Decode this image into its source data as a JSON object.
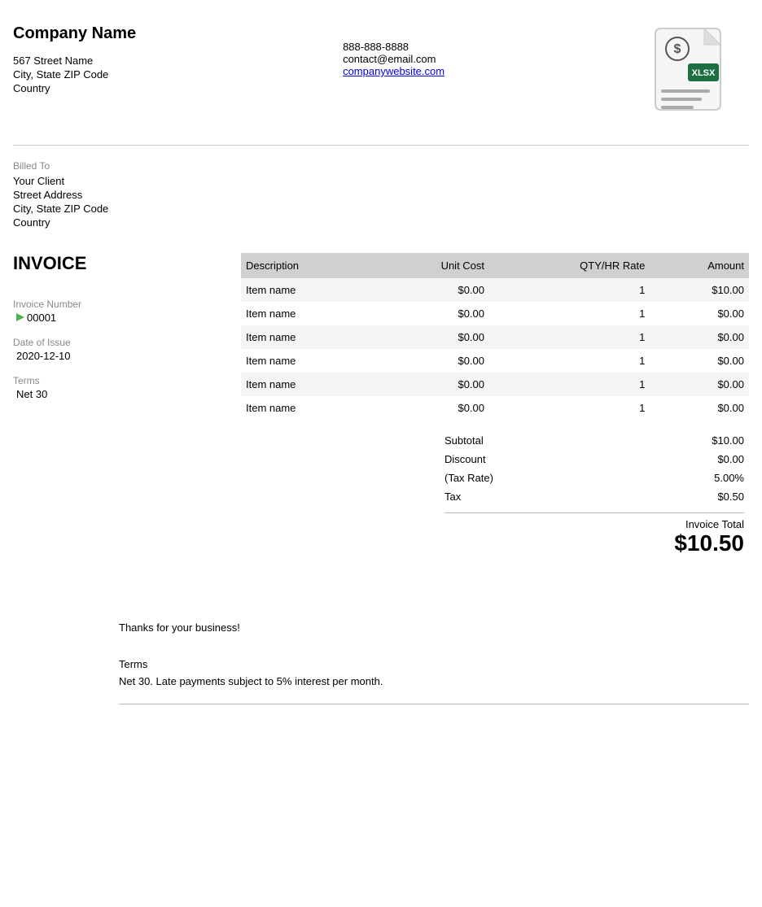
{
  "company": {
    "name": "Company Name",
    "address_line1": "567 Street Name",
    "address_line2": "City, State ZIP Code",
    "country": "Country",
    "phone": "888-888-8888",
    "email": "contact@email.com",
    "website": "companywebsite.com",
    "website_href": "companywebsite.com"
  },
  "billed_to": {
    "label": "Billed To",
    "client": "Your Client",
    "street": "Street Address",
    "city_state_zip": "City, State ZIP Code",
    "country": "Country"
  },
  "invoice": {
    "title": "INVOICE",
    "number_label": "Invoice Number",
    "number": "00001",
    "date_label": "Date of Issue",
    "date": "2020-12-10",
    "terms_label": "Terms",
    "terms_value": "Net 30"
  },
  "table": {
    "headers": [
      "Description",
      "Unit Cost",
      "QTY/HR Rate",
      "Amount"
    ],
    "rows": [
      {
        "description": "Item name",
        "unit_cost": "$0.00",
        "qty": "1",
        "amount": "$10.00"
      },
      {
        "description": "Item name",
        "unit_cost": "$0.00",
        "qty": "1",
        "amount": "$0.00"
      },
      {
        "description": "Item name",
        "unit_cost": "$0.00",
        "qty": "1",
        "amount": "$0.00"
      },
      {
        "description": "Item name",
        "unit_cost": "$0.00",
        "qty": "1",
        "amount": "$0.00"
      },
      {
        "description": "Item name",
        "unit_cost": "$0.00",
        "qty": "1",
        "amount": "$0.00"
      },
      {
        "description": "Item name",
        "unit_cost": "$0.00",
        "qty": "1",
        "amount": "$0.00"
      }
    ]
  },
  "totals": {
    "subtotal_label": "Subtotal",
    "subtotal_value": "$10.00",
    "discount_label": "Discount",
    "discount_value": "$0.00",
    "tax_rate_label": "(Tax Rate)",
    "tax_rate_value": "5.00%",
    "tax_label": "Tax",
    "tax_value": "$0.50",
    "invoice_total_label": "Invoice Total",
    "invoice_total_value": "$10.50"
  },
  "footer": {
    "thanks": "Thanks for your business!",
    "terms_label": "Terms",
    "terms_text": "Net 30. Late payments subject to 5% interest per month."
  }
}
